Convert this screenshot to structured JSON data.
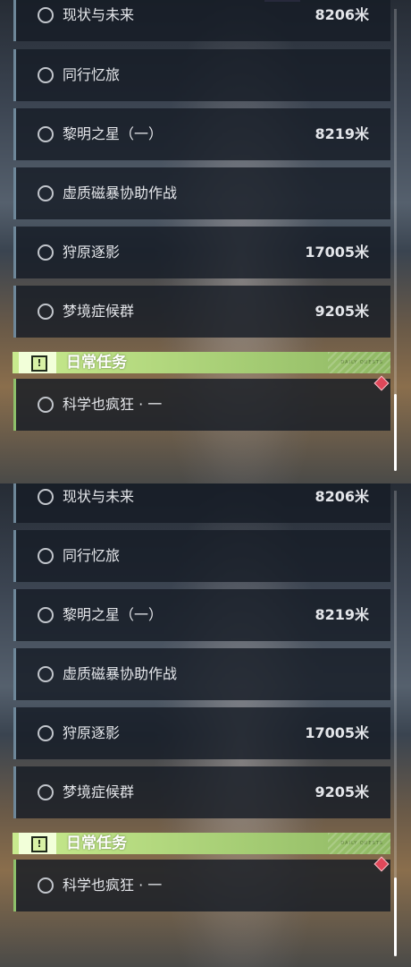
{
  "top_panel": {
    "quests": [
      {
        "title": "现状与未来",
        "distance": "8206米"
      },
      {
        "title": "同行忆旅",
        "distance": ""
      },
      {
        "title": "黎明之星（一）",
        "distance": "8219米"
      },
      {
        "title": "虚质磁暴协助作战",
        "distance": ""
      },
      {
        "title": "狩原逐影",
        "distance": "17005米"
      },
      {
        "title": "梦境症候群",
        "distance": "9205米"
      }
    ],
    "section": {
      "title": "日常任务",
      "code": "DAILY QUESTS"
    },
    "daily": [
      {
        "title": "科学也疯狂 · 一",
        "distance": ""
      }
    ]
  },
  "bottom_panel": {
    "quests": [
      {
        "title": "现状与未来",
        "distance": "8206米"
      },
      {
        "title": "同行忆旅",
        "distance": ""
      },
      {
        "title": "黎明之星（一）",
        "distance": "8219米"
      },
      {
        "title": "虚质磁暴协助作战",
        "distance": ""
      },
      {
        "title": "狩原逐影",
        "distance": "17005米"
      },
      {
        "title": "梦境症候群",
        "distance": "9205米"
      }
    ],
    "section": {
      "title": "日常任务",
      "code": "DAILY QUESTS"
    },
    "daily": [
      {
        "title": "科学也疯狂 · 一",
        "distance": ""
      }
    ]
  },
  "icons": {
    "quest_marker": "circle-ring-icon",
    "section_badge": "exclamation-icon",
    "new_indicator": "red-diamond-icon"
  },
  "colors": {
    "row_bg": "#161c26",
    "row_accent": "#6e8799",
    "daily_accent": "#8dc06a",
    "section_bg": "#b9dd82",
    "new_indicator": "#e0485a"
  }
}
